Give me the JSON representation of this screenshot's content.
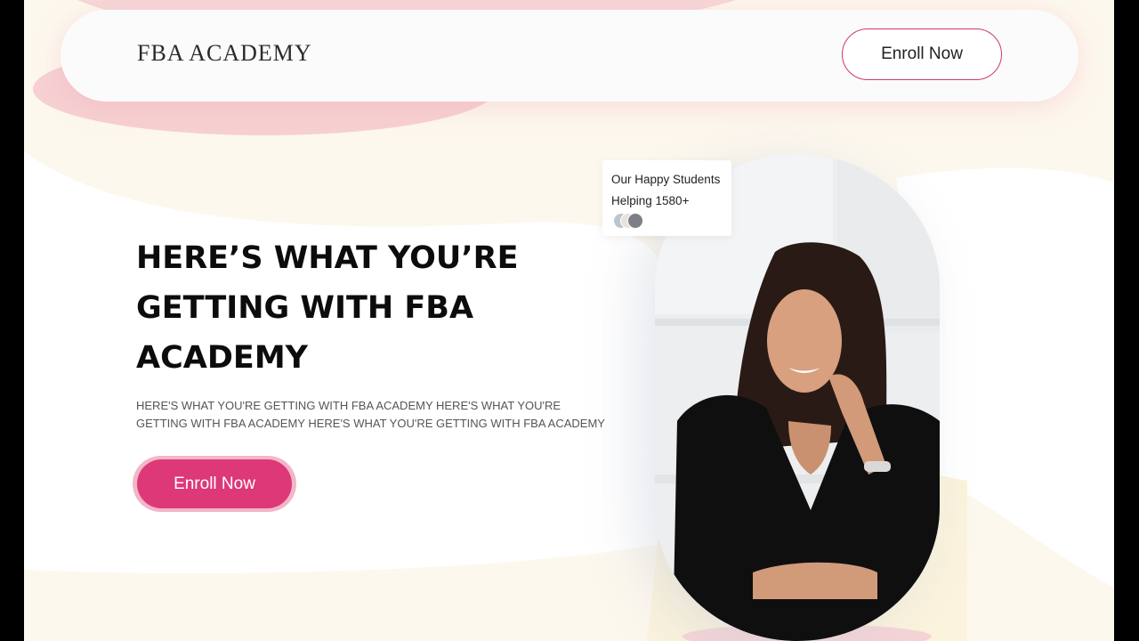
{
  "header": {
    "logo": "FBA ACADEMY",
    "enroll_label": "Enroll Now"
  },
  "hero": {
    "title": "HERE’S WHAT YOU’RE GETTING WITH FBA ACADEMY",
    "description": "HERE'S WHAT YOU'RE GETTING WITH FBA ACADEMY HERE'S WHAT YOU'RE GETTING WITH FBA ACADEMY HERE'S WHAT YOU'RE GETTING WITH FBA ACADEMY",
    "enroll_label": "Enroll Now"
  },
  "students_card": {
    "line1": "Our Happy Students",
    "line2": "Helping 1580+"
  },
  "colors": {
    "accent": "#dd3878",
    "accent_light": "#f2b6c8",
    "cream": "#fdf8ee",
    "blush": "#f6d4d6"
  }
}
